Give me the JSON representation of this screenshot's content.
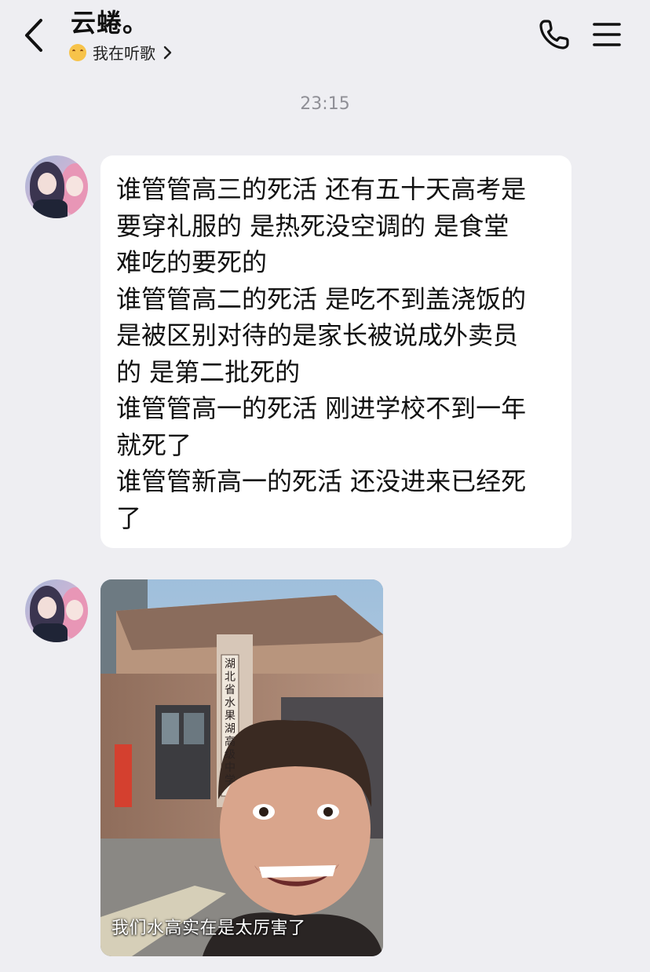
{
  "header": {
    "title": "云蜷。",
    "status_text": "我在听歌",
    "icons": {
      "back": "back-chevron-icon",
      "status": "smiling-face-icon",
      "status_more": "chevron-right-icon",
      "call": "phone-icon",
      "menu": "menu-icon"
    }
  },
  "chat": {
    "timestamp": "23:15",
    "messages": [
      {
        "type": "text",
        "lines": [
          "谁管管高三的死活 还有五十天高考是",
          "要穿礼服的 是热死没空调的 是食堂",
          "难吃的要死的",
          "谁管管高二的死活 是吃不到盖浇饭的",
          "是被区别对待的是家长被说成外卖员",
          "的 是第二批死的",
          "谁管管高一的死活 刚进学校不到一年",
          "就死了",
          "谁管管新高一的死活 还没进来已经死",
          "了"
        ]
      },
      {
        "type": "image",
        "caption": "我们水高实在是太厉害了",
        "sign_text": "湖北省水果湖高级中学"
      }
    ]
  },
  "colors": {
    "background": "#eeeef2",
    "bubble": "#ffffff",
    "timestamp": "#8f8f96",
    "text": "#111111"
  }
}
